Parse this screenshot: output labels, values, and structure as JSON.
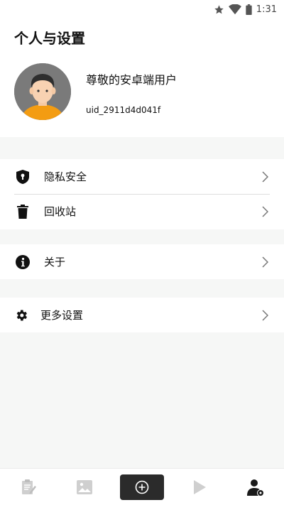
{
  "status_bar": {
    "time": "1:31",
    "icons": [
      "star-icon",
      "wifi-icon",
      "battery-icon"
    ]
  },
  "header": {
    "title": "个人与设置"
  },
  "profile": {
    "name": "尊敬的安卓端用户",
    "uid": "uid_2911d4d041f",
    "avatar": "avatar-person-icon"
  },
  "menu": {
    "privacy": {
      "label": "隐私安全",
      "icon": "shield-lock-icon"
    },
    "recycle": {
      "label": "回收站",
      "icon": "trash-icon"
    },
    "about": {
      "label": "关于",
      "icon": "info-icon"
    },
    "more": {
      "label": "更多设置",
      "icon": "gear-icon"
    }
  },
  "bottom_nav": {
    "items": [
      "notes-icon",
      "gallery-icon",
      "create-plus-icon",
      "play-icon",
      "profile-icon"
    ],
    "active": "profile-icon"
  },
  "colors": {
    "background": "#f6f7f6",
    "card": "#ffffff",
    "create_button": "#2b2b2b",
    "avatar_bg": "#7a7a7a",
    "avatar_shirt": "#f39c12"
  }
}
